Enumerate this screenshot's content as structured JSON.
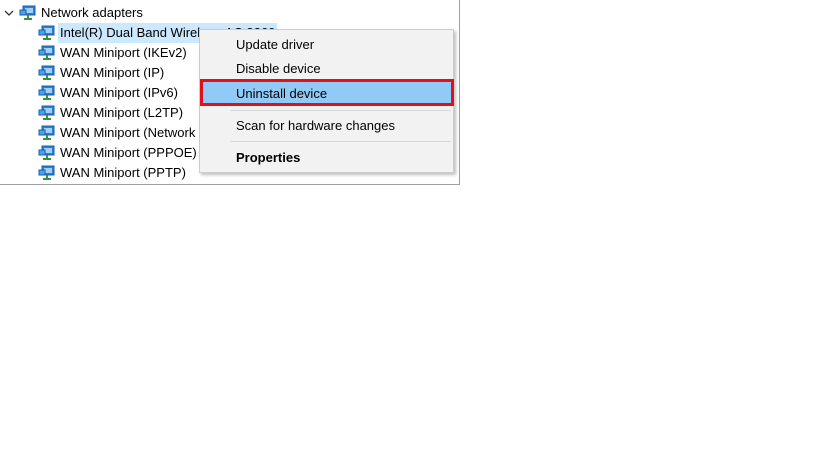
{
  "tree": {
    "category_label": "Network adapters",
    "category_icon": "network-adapter-icon",
    "devices": [
      {
        "label": "Intel(R) Dual Band Wireless-AC 8260",
        "selected": true
      },
      {
        "label": "WAN Miniport (IKEv2)",
        "selected": false
      },
      {
        "label": "WAN Miniport (IP)",
        "selected": false
      },
      {
        "label": "WAN Miniport (IPv6)",
        "selected": false
      },
      {
        "label": "WAN Miniport (L2TP)",
        "selected": false
      },
      {
        "label": "WAN Miniport (Network Monitor)",
        "selected": false
      },
      {
        "label": "WAN Miniport (PPPOE)",
        "selected": false
      },
      {
        "label": "WAN Miniport (PPTP)",
        "selected": false
      }
    ]
  },
  "context_menu": {
    "items": [
      {
        "label": "Update driver"
      },
      {
        "label": "Disable device"
      },
      {
        "label": "Uninstall device",
        "highlighted": true
      },
      {
        "label": "Scan for hardware changes"
      },
      {
        "label": "Properties",
        "bold": true
      }
    ]
  },
  "colors": {
    "selection": "#cce8ff",
    "menu_highlight": "#91c9f7",
    "callout_border": "#e0101a"
  }
}
